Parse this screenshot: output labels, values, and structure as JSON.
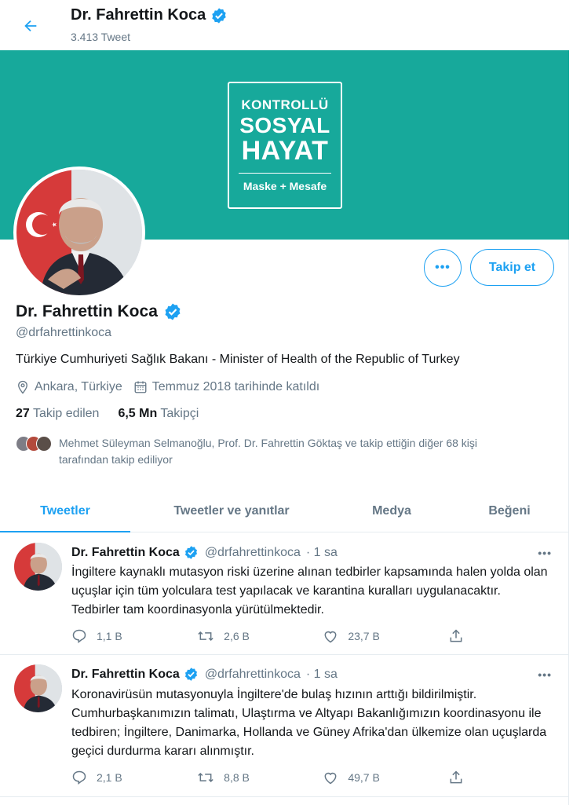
{
  "header": {
    "name": "Dr. Fahrettin Koca",
    "tweet_count": "3.413 Tweet"
  },
  "banner": {
    "line1": "KONTROLLÜ",
    "line2": "SOSYAL",
    "line3": "HAYAT",
    "line4": "Maske + Mesafe"
  },
  "actions": {
    "more_label": "•••",
    "follow_label": "Takip et"
  },
  "profile": {
    "name": "Dr. Fahrettin Koca",
    "handle": "@drfahrettinkoca",
    "bio": "Türkiye Cumhuriyeti Sağlık Bakanı - Minister of Health of the Republic of Turkey",
    "location": "Ankara, Türkiye",
    "joined": "Temmuz 2018 tarihinde katıldı",
    "following_count": "27",
    "following_label": "Takip edilen",
    "followers_count": "6,5 Mn",
    "followers_label": "Takipçi",
    "known_line1": "Mehmet Süleyman Selmanoğlu, Prof. Dr. Fahrettin Göktaş ve takip ettiğin diğer 68 kişi",
    "known_line2": "tarafından takip ediliyor"
  },
  "tabs": [
    "Tweetler",
    "Tweetler ve yanıtlar",
    "Medya",
    "Beğeni"
  ],
  "tweets": [
    {
      "name": "Dr. Fahrettin Koca",
      "handle": "@drfahrettinkoca",
      "time": "· 1 sa",
      "text": "İngiltere kaynaklı mutasyon riski üzerine alınan tedbirler kapsamında halen yolda olan uçuşlar için tüm yolculara test yapılacak ve karantina kuralları uygulanacaktır. Tedbirler tam koordinasyonla yürütülmektedir.",
      "replies": "1,1 B",
      "retweets": "2,6 B",
      "likes": "23,7 B"
    },
    {
      "name": "Dr. Fahrettin Koca",
      "handle": "@drfahrettinkoca",
      "time": "· 1 sa",
      "text": "Koronavirüsün mutasyonuyla İngiltere'de bulaş hızının arttığı bildirilmiştir. Cumhurbaşkanımızın talimatı, Ulaştırma ve Altyapı Bakanlığımızın koordinasyonu ile tedbiren; İngiltere, Danimarka, Hollanda ve Güney Afrika'dan ülkemize olan uçuşlarda geçici durdurma kararı alınmıştır.",
      "replies": "2,1 B",
      "retweets": "8,8 B",
      "likes": "49,7 B"
    }
  ],
  "colors": {
    "accent": "#1da1f2",
    "banner": "#17a99b",
    "muted": "#657786"
  }
}
